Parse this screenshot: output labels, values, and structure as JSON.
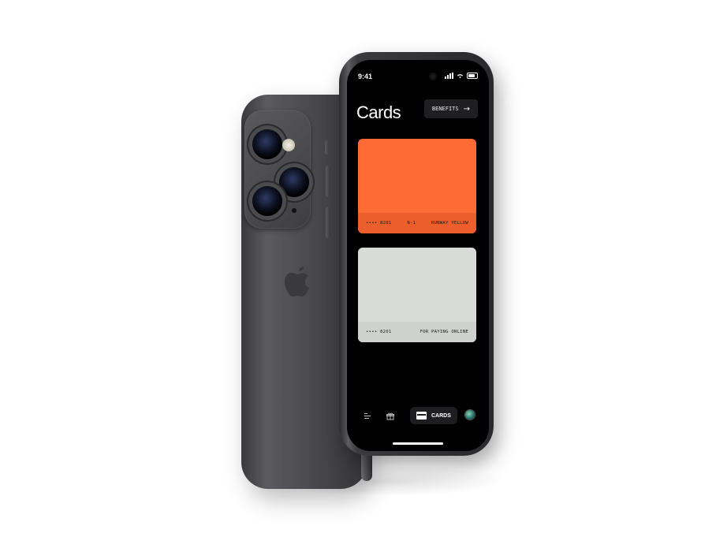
{
  "status_bar": {
    "time": "9:41"
  },
  "header": {
    "title": "Cards",
    "benefits_label": "BENEFITS"
  },
  "cards": [
    {
      "color": "#ff6b35",
      "last_digits": "•••• 8201",
      "tier": "N-1",
      "name": "RUNWAY YELLOW"
    },
    {
      "color": "#d9dbd8",
      "last_digits": "•••• 8201",
      "tier": "",
      "name": "FOR PAYING ONLINE"
    }
  ],
  "tabbar": {
    "items": [
      {
        "icon": "menu-icon"
      },
      {
        "icon": "gift-icon"
      },
      {
        "icon": "card-icon",
        "label": "CARDS",
        "active": true
      },
      {
        "icon": "avatar"
      }
    ]
  },
  "colors": {
    "accent": "#ff6b35",
    "screen_bg": "#000000",
    "phone_body": "#4a4a4d"
  }
}
